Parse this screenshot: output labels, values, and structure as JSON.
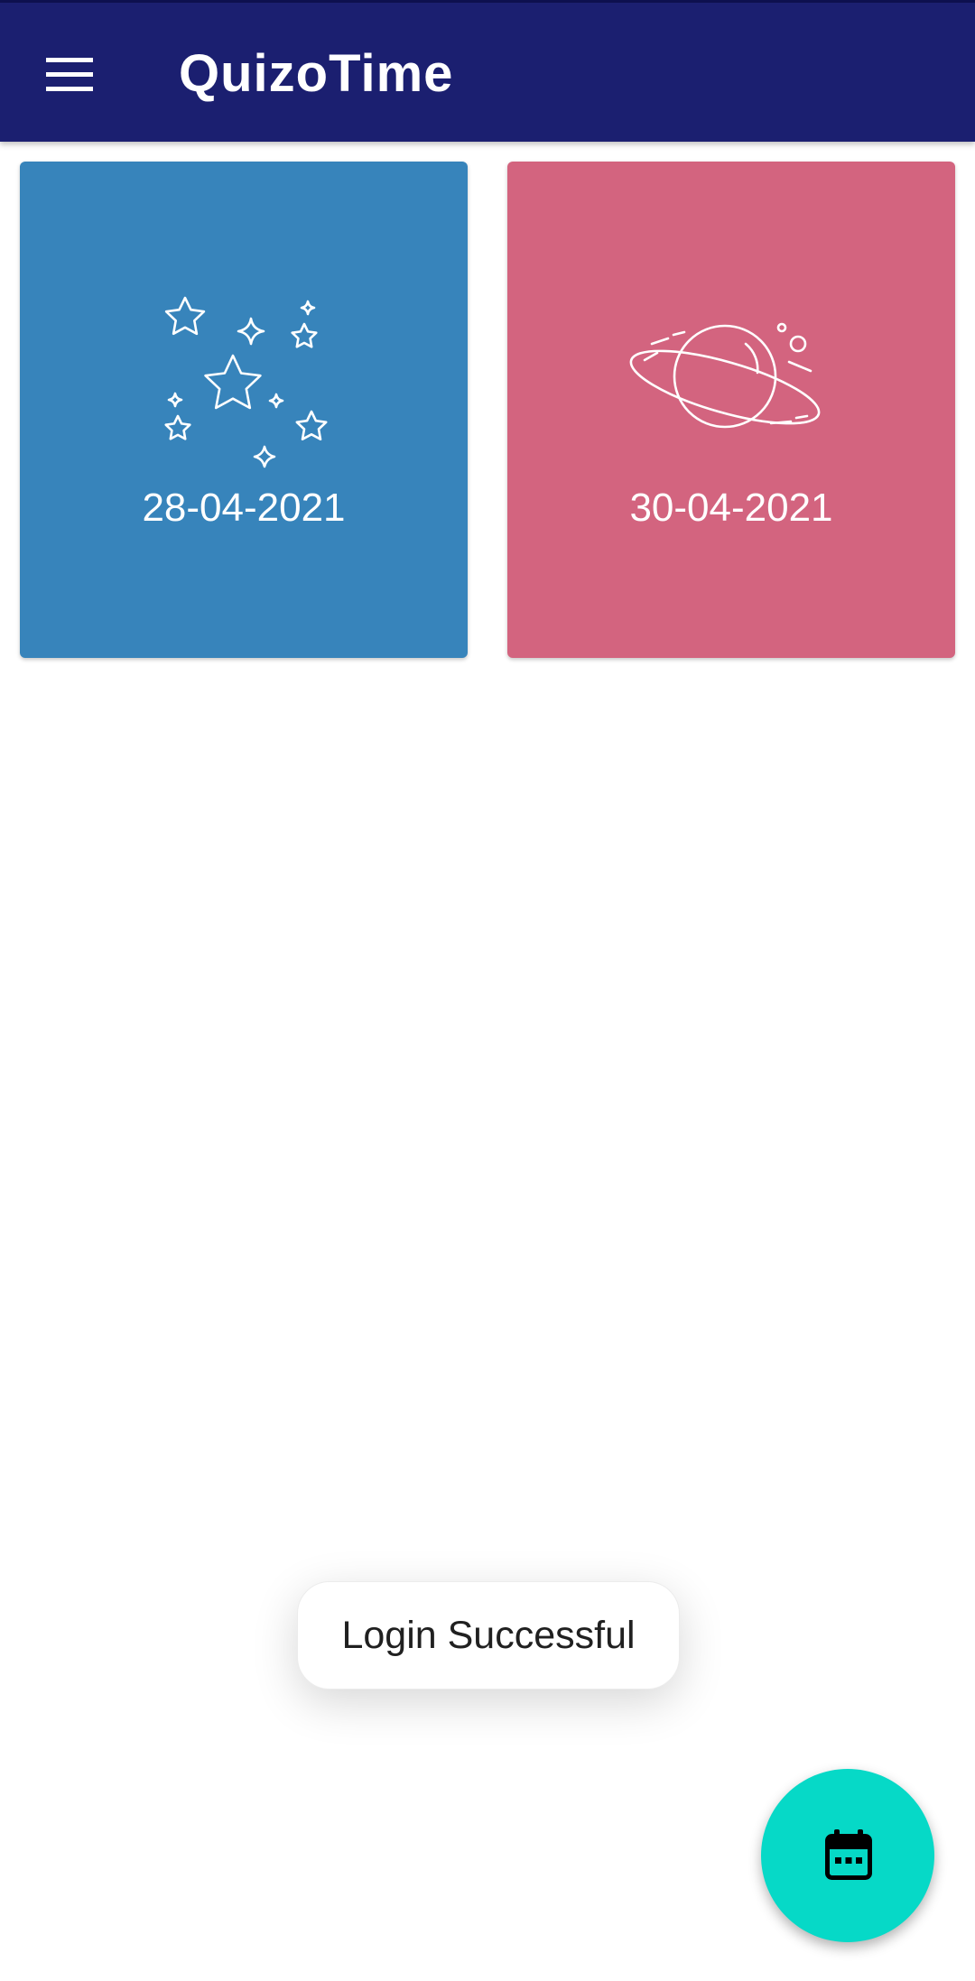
{
  "app_bar": {
    "title": "QuizoTime",
    "menu_icon": "hamburger-menu-icon",
    "background": "#1b1f70"
  },
  "cards": [
    {
      "date": "28-04-2021",
      "icon": "stars-icon",
      "color": "#3784bb"
    },
    {
      "date": "30-04-2021",
      "icon": "planet-icon",
      "color": "#d3647f"
    }
  ],
  "toast": {
    "text": "Login Successful"
  },
  "fab": {
    "icon": "calendar-icon",
    "color": "#06d9c7"
  }
}
